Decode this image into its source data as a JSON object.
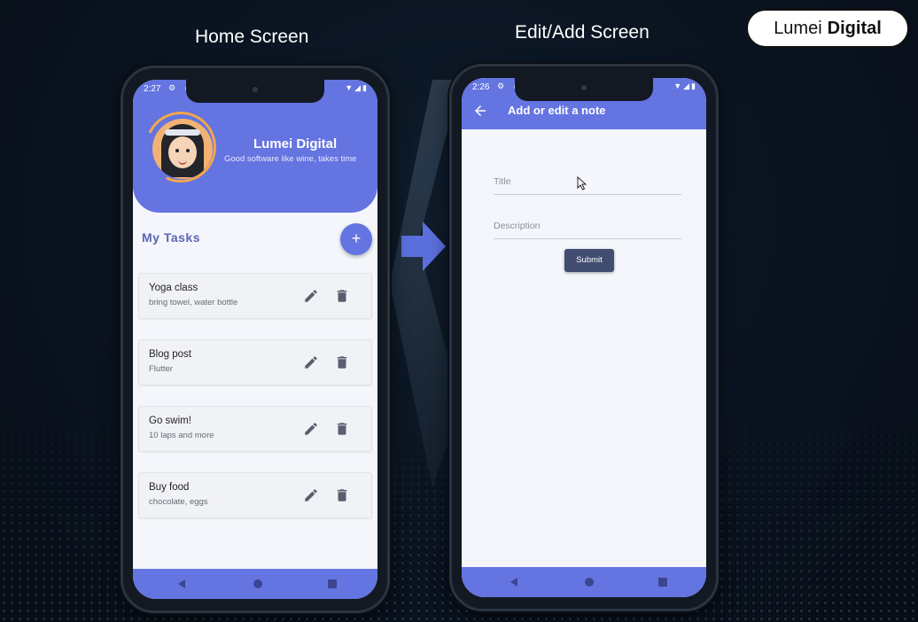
{
  "captions": {
    "home": "Home Screen",
    "edit": "Edit/Add Screen"
  },
  "brand": {
    "regular": "Lumei",
    "bold": "Digital"
  },
  "home_screen": {
    "status_time": "2:27",
    "profile_name": "Lumei Digital",
    "profile_tagline": "Good software like wine, takes time",
    "section_title": "My Tasks",
    "add_button_label": "+",
    "tasks": [
      {
        "title": "Yoga class",
        "description": "bring towel, water bottle"
      },
      {
        "title": "Blog post",
        "description": "Flutter"
      },
      {
        "title": "Go swim!",
        "description": "10 laps and more"
      },
      {
        "title": "Buy food",
        "description": "chocolate, eggs"
      }
    ]
  },
  "edit_screen": {
    "status_time": "2:26",
    "appbar_title": "Add or edit a note",
    "title_placeholder": "Title",
    "description_placeholder": "Description",
    "submit_label": "Submit"
  },
  "icons": {
    "back": "arrow-left-icon",
    "edit": "pencil-icon",
    "delete": "trash-icon",
    "nav_back": "triangle-back-icon",
    "nav_home": "circle-home-icon",
    "nav_recents": "square-recents-icon"
  },
  "colors": {
    "primary": "#6474e1",
    "submit": "#414d70",
    "background": "#0a1320"
  }
}
